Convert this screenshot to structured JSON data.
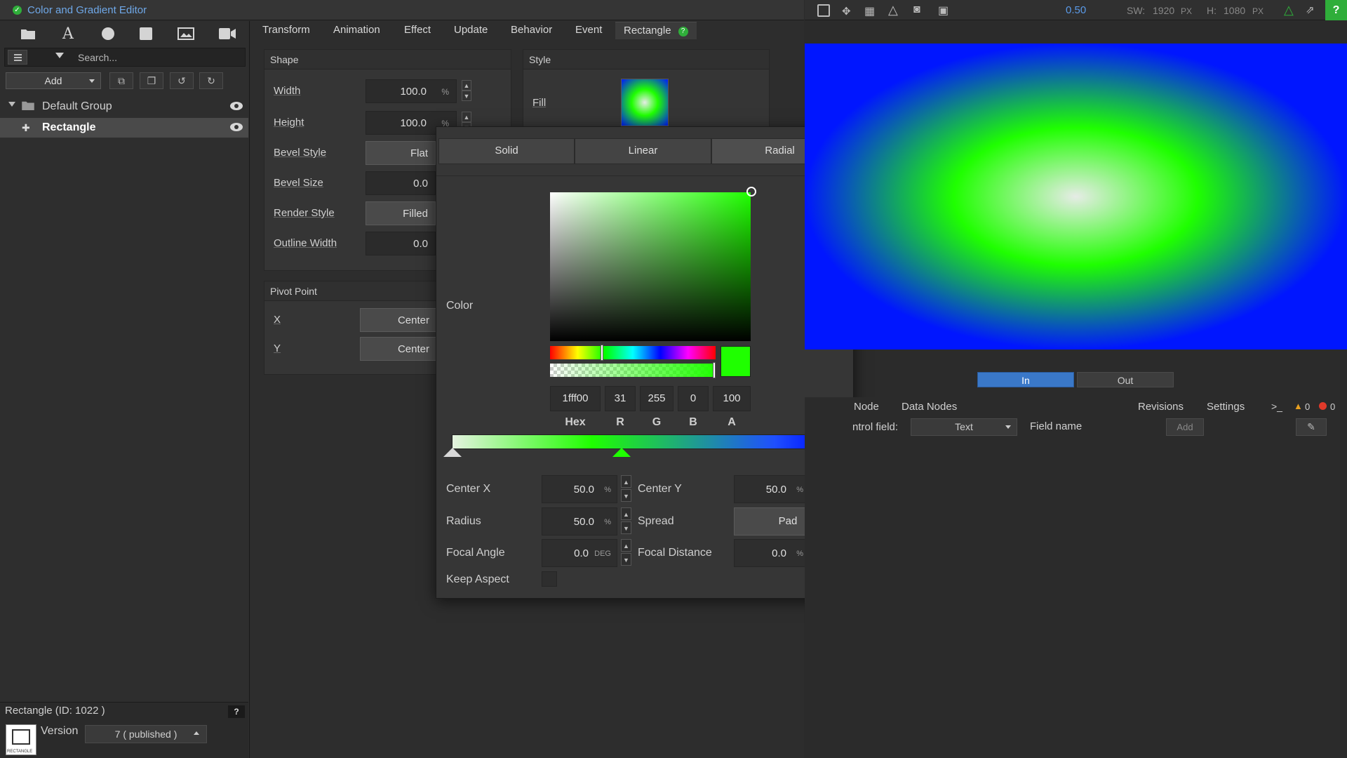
{
  "app": {
    "title": "Color and Gradient Editor"
  },
  "left": {
    "search_placeholder": "Search...",
    "add_label": "Add",
    "tree": [
      {
        "label": "Default Group"
      },
      {
        "label": "Rectangle"
      }
    ],
    "footer": {
      "object_label": "Rectangle (ID: 1022 )",
      "help": "?",
      "version_label": "Version",
      "version_value": "7 ( published )",
      "thumb_caption": "RECTANGLE"
    }
  },
  "tabs": [
    "Transform",
    "Animation",
    "Effect",
    "Update",
    "Behavior",
    "Event",
    "Rectangle"
  ],
  "shape": {
    "header": "Shape",
    "width_label": "Width",
    "width_value": "100.0",
    "width_unit": "%",
    "height_label": "Height",
    "height_value": "100.0",
    "height_unit": "%",
    "bevel_style_label": "Bevel Style",
    "bevel_style_value": "Flat",
    "bevel_size_label": "Bevel Size",
    "bevel_size_value": "0.0",
    "render_style_label": "Render Style",
    "render_style_value": "Filled",
    "outline_width_label": "Outline Width",
    "outline_width_value": "0.0"
  },
  "style": {
    "header": "Style",
    "fill_label": "Fill"
  },
  "pivot": {
    "header": "Pivot Point",
    "x_label": "X",
    "x_value": "Center",
    "y_label": "Y",
    "y_value": "Center"
  },
  "popup": {
    "modes": [
      "Solid",
      "Linear",
      "Radial"
    ],
    "active_mode": "Radial",
    "color_label": "Color",
    "selected_color": "#1fff00",
    "hex": "1fff00",
    "r": "31",
    "g": "255",
    "b": "0",
    "a": "100",
    "hex_label": "Hex",
    "r_label": "R",
    "g_label": "G",
    "b_label": "B",
    "a_label": "A",
    "center_x_label": "Center X",
    "center_x": "50.0",
    "center_x_unit": "%",
    "center_y_label": "Center Y",
    "center_y": "50.0",
    "center_y_unit": "%",
    "radius_label": "Radius",
    "radius": "50.0",
    "radius_unit": "%",
    "spread_label": "Spread",
    "spread": "Pad",
    "focal_angle_label": "Focal Angle",
    "focal_angle": "0.0",
    "focal_angle_unit": "DEG",
    "focal_distance_label": "Focal Distance",
    "focal_distance": "0.0",
    "focal_distance_unit": "%",
    "keep_aspect_label": "Keep Aspect"
  },
  "preview_toolbar": {
    "zoom": "0.50",
    "sw_label": "SW:",
    "sw_value": "1920",
    "sw_unit": "PX",
    "h_label": "H:",
    "h_value": "1080",
    "h_unit": "PX",
    "help": "?"
  },
  "inout": {
    "in": "In",
    "out": "Out"
  },
  "bottom": {
    "tabs": [
      "Node",
      "Data Nodes",
      "Revisions",
      "Settings"
    ],
    "console": ">_",
    "warnings": "0",
    "errors": "0",
    "control_field_label": "ntrol field:",
    "control_field_value": "Text",
    "field_name_label": "Field name",
    "add_label": "Add"
  }
}
